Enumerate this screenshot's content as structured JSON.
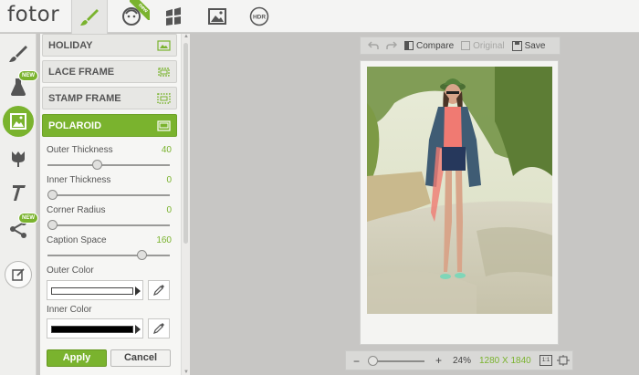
{
  "app": {
    "logo": "fotor"
  },
  "topbar": {
    "tabs": [
      {
        "name": "edit-brush",
        "active": true
      },
      {
        "name": "beauty-face",
        "badge": "new"
      },
      {
        "name": "collage"
      },
      {
        "name": "frames-image"
      },
      {
        "name": "hdr",
        "label": "HDR"
      }
    ]
  },
  "lefttools": {
    "badge_new": "NEW",
    "items": [
      "brush-icon",
      "effects-flask-icon",
      "frames-icon",
      "stickers-icon",
      "text-icon",
      "share-icon",
      "edit-note-icon"
    ]
  },
  "frames": {
    "items": [
      {
        "label": "HOLIDAY"
      },
      {
        "label": "LACE FRAME"
      },
      {
        "label": "STAMP FRAME"
      },
      {
        "label": "POLAROID",
        "active": true
      }
    ]
  },
  "settings": {
    "outer_thickness": {
      "label": "Outer Thickness",
      "value": "40",
      "fraction": 0.4
    },
    "inner_thickness": {
      "label": "Inner Thickness",
      "value": "0",
      "fraction": 0.0
    },
    "corner_radius": {
      "label": "Corner Radius",
      "value": "0",
      "fraction": 0.0
    },
    "caption_space": {
      "label": "Caption Space",
      "value": "160",
      "fraction": 0.8
    },
    "outer_color": {
      "label": "Outer Color",
      "color": "#ffffff"
    },
    "inner_color": {
      "label": "Inner Color",
      "color": "#000000"
    }
  },
  "actions": {
    "apply": "Apply",
    "cancel": "Cancel"
  },
  "canvas_toolbar": {
    "compare": "Compare",
    "original": "Original",
    "save": "Save"
  },
  "zoom": {
    "minus": "−",
    "plus": "+",
    "percent": "24%",
    "dimensions": "1280 X 1840",
    "fraction": 0.0
  },
  "colors": {
    "accent": "#7ab32e",
    "panel_bg": "#f6f6f4",
    "canvas_bg": "#c7c6c4"
  }
}
